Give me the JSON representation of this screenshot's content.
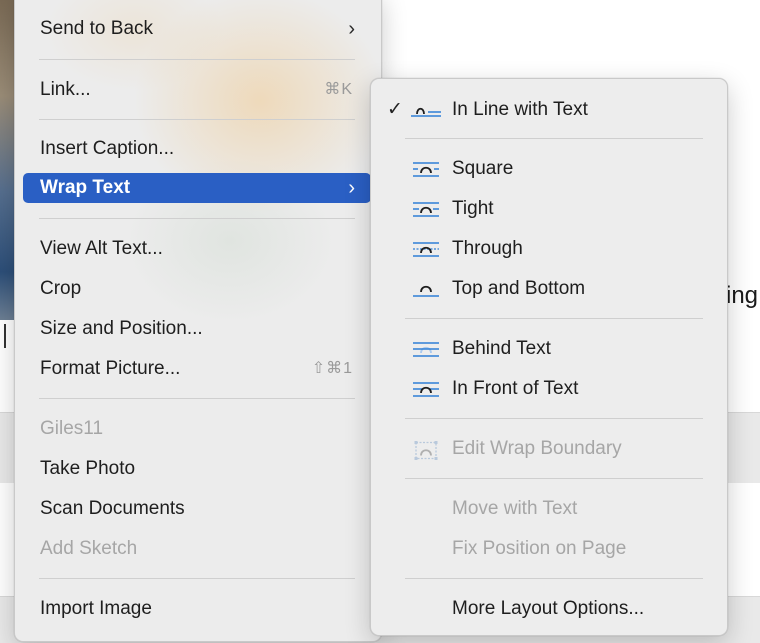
{
  "background": {
    "doc_text_fragment": "ing"
  },
  "main_menu": {
    "send_to_back": {
      "label": "Send to Back",
      "chevron": "›"
    },
    "link": {
      "label": "Link...",
      "shortcut": "⌘K"
    },
    "insert_caption": {
      "label": "Insert Caption..."
    },
    "wrap_text": {
      "label": "Wrap Text",
      "chevron": "›"
    },
    "view_alt_text": {
      "label": "View Alt Text..."
    },
    "crop": {
      "label": "Crop"
    },
    "size_and_position": {
      "label": "Size and Position..."
    },
    "format_picture": {
      "label": "Format Picture...",
      "shortcut": "⇧⌘1"
    },
    "giles11": {
      "label": "Giles11"
    },
    "take_photo": {
      "label": "Take Photo"
    },
    "scan_documents": {
      "label": "Scan Documents"
    },
    "add_sketch": {
      "label": "Add Sketch"
    },
    "import_image": {
      "label": "Import Image"
    }
  },
  "wrap_submenu": {
    "checkmark": "✓",
    "in_line_with_text": {
      "label": "In Line with Text"
    },
    "square": {
      "label": "Square"
    },
    "tight": {
      "label": "Tight"
    },
    "through": {
      "label": "Through"
    },
    "top_and_bottom": {
      "label": "Top and Bottom"
    },
    "behind_text": {
      "label": "Behind Text"
    },
    "in_front_of_text": {
      "label": "In Front of Text"
    },
    "edit_wrap_boundary": {
      "label": "Edit Wrap Boundary"
    },
    "move_with_text": {
      "label": "Move with Text"
    },
    "fix_position_on_page": {
      "label": "Fix Position on Page"
    },
    "more_layout_options": {
      "label": "More Layout Options..."
    }
  },
  "colors": {
    "highlight": "#2a5fc4",
    "icon_blue": "#2f7fd6",
    "disabled_text": "#a6a6a6"
  },
  "icons": [
    "chevron-right-icon",
    "checkmark-icon",
    "wrap-inline-icon",
    "wrap-square-icon",
    "wrap-tight-icon",
    "wrap-through-icon",
    "wrap-top-bottom-icon",
    "wrap-behind-icon",
    "wrap-front-icon",
    "edit-wrap-boundary-icon"
  ]
}
